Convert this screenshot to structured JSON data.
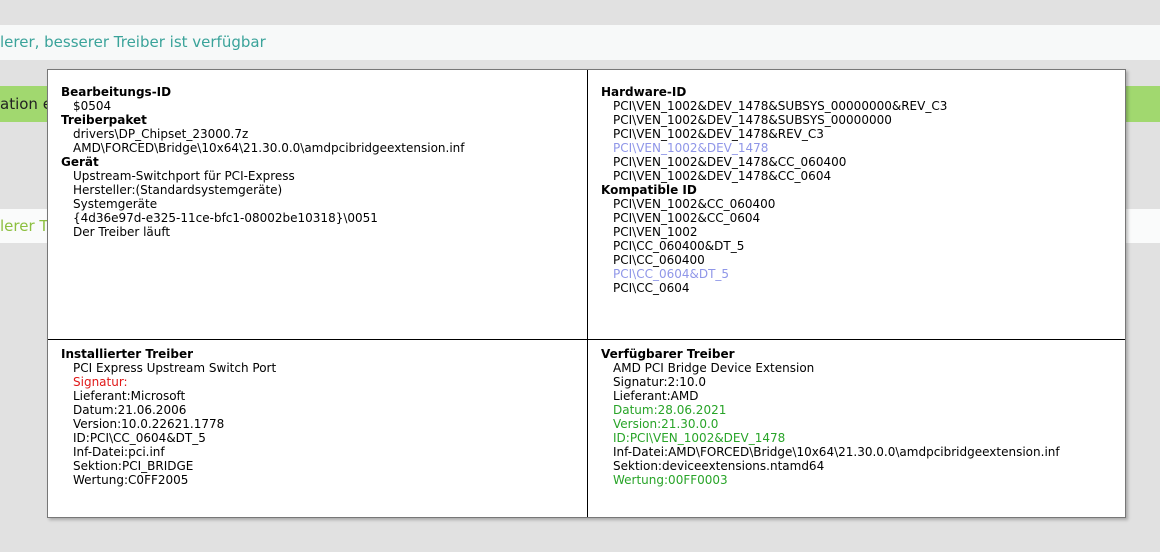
{
  "background": {
    "row1_text": "lerer, besserer Treiber ist verfügbar",
    "row2_text": "ation e",
    "row3_text": "lerer T"
  },
  "tooltip": {
    "top_left": {
      "edit_id_label": "Bearbeitungs-ID",
      "edit_id_value": "$0504",
      "package_label": "Treiberpaket",
      "package_lines": [
        "drivers\\DP_Chipset_23000.7z",
        "AMD\\FORCED\\Bridge\\10x64\\21.30.0.0\\amdpcibridgeextension.inf"
      ],
      "device_label": "Gerät",
      "device_lines": [
        "Upstream-Switchport für PCI-Express",
        "Hersteller:(Standardsystemgeräte)",
        "Systemgeräte",
        "{4d36e97d-e325-11ce-bfc1-08002be10318}\\0051",
        "Der Treiber läuft"
      ]
    },
    "top_right": {
      "hardware_label": "Hardware-ID",
      "hardware_ids": [
        "PCI\\VEN_1002&DEV_1478&SUBSYS_00000000&REV_C3",
        "PCI\\VEN_1002&DEV_1478&SUBSYS_00000000",
        "PCI\\VEN_1002&DEV_1478&REV_C3",
        "PCI\\VEN_1002&DEV_1478",
        "PCI\\VEN_1002&DEV_1478&CC_060400",
        "PCI\\VEN_1002&DEV_1478&CC_0604"
      ],
      "compatible_label": "Kompatible ID",
      "compatible_ids": [
        "PCI\\VEN_1002&CC_060400",
        "PCI\\VEN_1002&CC_0604",
        "PCI\\VEN_1002",
        "PCI\\CC_060400&DT_5",
        "PCI\\CC_060400",
        "PCI\\CC_0604&DT_5",
        "PCI\\CC_0604"
      ]
    },
    "bottom_left": {
      "label": "Installierter Treiber",
      "name": "PCI Express Upstream Switch Port",
      "signature": "Signatur:",
      "vendor": "Lieferant:Microsoft",
      "date": "Datum:21.06.2006",
      "version": "Version:10.0.22621.1778",
      "id": "ID:PCI\\CC_0604&DT_5",
      "inf": "Inf-Datei:pci.inf",
      "section": "Sektion:PCI_BRIDGE",
      "rating": "Wertung:C0FF2005"
    },
    "bottom_right": {
      "label": "Verfügbarer Treiber",
      "name": "AMD PCI Bridge Device Extension",
      "signature": "Signatur:2:10.0",
      "vendor": "Lieferant:AMD",
      "date": "Datum:28.06.2021",
      "version": "Version:21.30.0.0",
      "id": "ID:PCI\\VEN_1002&DEV_1478",
      "inf": "Inf-Datei:AMD\\FORCED\\Bridge\\10x64\\21.30.0.0\\amdpcibridgeextension.inf",
      "section": "Sektion:deviceextensions.ntamd64",
      "rating": "Wertung:00FF0003"
    }
  },
  "colors": {
    "highlight_blue": "#8f96e8",
    "warning_red": "#e01818",
    "better_green": "#28a428",
    "row_green": "#a1d86f"
  }
}
